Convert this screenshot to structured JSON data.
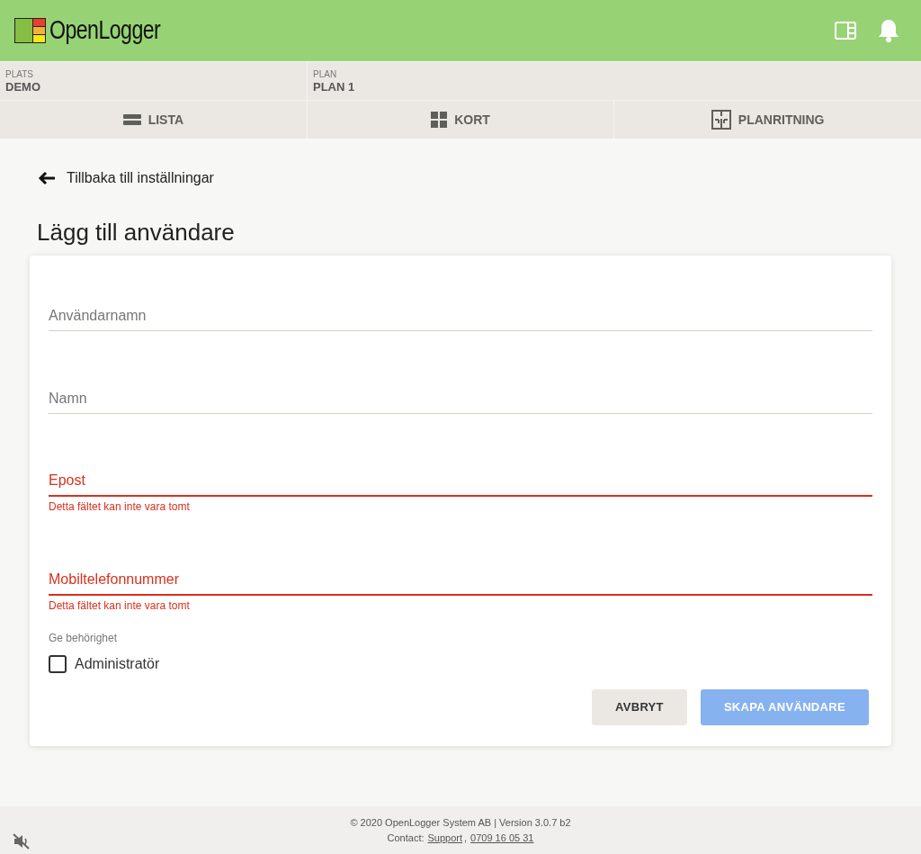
{
  "header": {
    "logo_text": "OpenLogger"
  },
  "context": [
    {
      "label": "PLATS",
      "value": "DEMO"
    },
    {
      "label": "PLAN",
      "value": "PLAN 1"
    }
  ],
  "view_tabs": [
    {
      "label": "LISTA",
      "kind": "list"
    },
    {
      "label": "KORT",
      "kind": "grid"
    },
    {
      "label": "PLANRITNING",
      "kind": "plan"
    }
  ],
  "back_link": "Tillbaka till inställningar",
  "page_title": "Lägg till användare",
  "form": {
    "fields": [
      {
        "placeholder": "Användarnamn",
        "error": false
      },
      {
        "placeholder": "Namn",
        "error": false
      },
      {
        "placeholder": "Epost",
        "error": true,
        "error_text": "Detta fältet kan inte vara tomt"
      },
      {
        "placeholder": "Mobiltelefonnummer",
        "error": true,
        "error_text": "Detta fältet kan inte vara tomt"
      }
    ],
    "permission_label": "Ge behörighet",
    "checkbox": {
      "label": "Administratör",
      "checked": false
    },
    "buttons": [
      {
        "label": "AVBRYT",
        "kind": "secondary",
        "disabled": false
      },
      {
        "label": "SKAPA ANVÄNDARE",
        "kind": "primary",
        "disabled": true
      }
    ]
  },
  "footer": {
    "line1": "© 2020 OpenLogger System AB | Version 3.0.7 b2",
    "contact_label": "Contact:",
    "links": [
      "Support",
      "0709 16 05 31"
    ],
    "link_separator": ","
  }
}
